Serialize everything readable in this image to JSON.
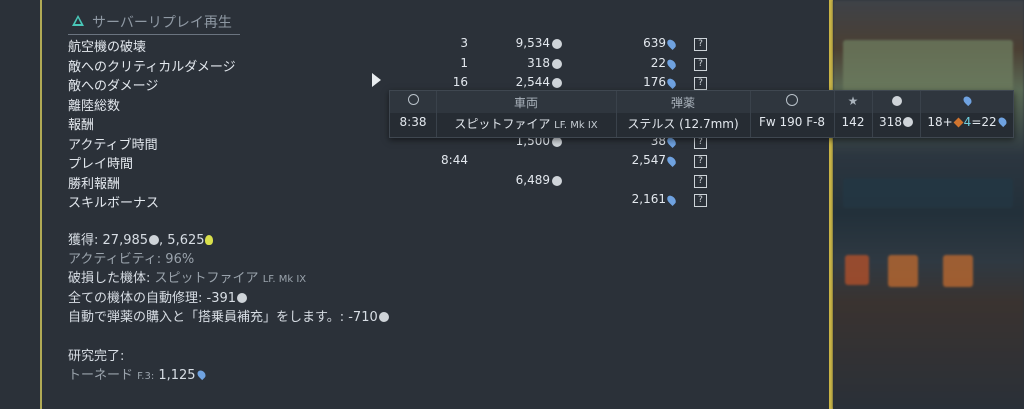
{
  "header": {
    "title": "サーバーリプレイ再生"
  },
  "rows": [
    {
      "label": "航空機の破壊",
      "count": "3",
      "sl": "9,534",
      "rp": "639"
    },
    {
      "label": "敵へのクリティカルダメージ",
      "count": "1",
      "sl": "318",
      "rp": "22"
    },
    {
      "label": "敵へのダメージ",
      "count": "16",
      "sl": "2,544",
      "rp": "176"
    },
    {
      "label": "離陸総数",
      "count": "",
      "sl": "",
      "rp": ""
    },
    {
      "label": "報酬",
      "count": "",
      "sl": "",
      "rp": ""
    },
    {
      "label": "アクティブ時間",
      "count": "",
      "sl": "1,500",
      "rp": "38"
    },
    {
      "label": "プレイ時間",
      "count": "8:44",
      "sl": "",
      "rp": "2,547"
    },
    {
      "label": "勝利報酬",
      "count": "",
      "sl": "6,489",
      "rp": ""
    },
    {
      "label": "スキルボーナス",
      "count": "",
      "sl": "",
      "rp": "2,161"
    }
  ],
  "help_glyph": "?",
  "summary": {
    "earned_label": "獲得:",
    "earned_sl": "27,985",
    "earned_rp": "5,625",
    "activity": "アクティビティ: 96%",
    "damaged_label": "破損した機体:",
    "damaged_vehicle": "スピットファイア",
    "damaged_suffix": "LF. Mk IX",
    "repair_label": "全ての機体の自動修理:",
    "repair_value": "-391",
    "ammo_label": "自動で弾薬の購入と「搭乗員補充」をします。:",
    "ammo_value": "-710"
  },
  "research": {
    "title": "研究完了:",
    "item_name": "トーネード",
    "item_suffix": "F.3:",
    "item_value": "1,125"
  },
  "tooltip": {
    "headers": {
      "vehicle": "車両",
      "ammo": "弾薬"
    },
    "time": "8:38",
    "vehicle": "スピットファイア",
    "vehicle_suffix": "LF. Mk IX",
    "ammo": "ステルス (12.7mm)",
    "target": "Fw 190 F-8",
    "score": "142",
    "sl": "318",
    "rp_formula": "18+",
    "rp_mult": "4",
    "rp_result": "=22"
  },
  "colors": {
    "accent": "#49c7b8",
    "frame": "#c9b445",
    "rp": "#6fa2e0"
  }
}
